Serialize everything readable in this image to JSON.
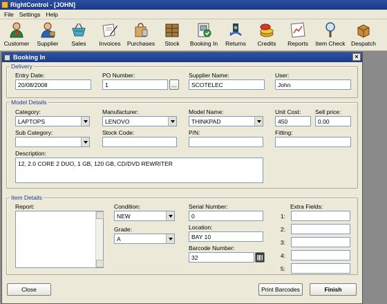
{
  "app": {
    "title": "RightControl - [JOHN]"
  },
  "menu": {
    "items": [
      "File",
      "Settings",
      "Help"
    ]
  },
  "toolbar": {
    "buttons": [
      {
        "label": "Customer",
        "icon": "customer-icon"
      },
      {
        "label": "Supplier",
        "icon": "supplier-icon"
      },
      {
        "label": "Sales",
        "icon": "sales-basket-icon"
      },
      {
        "label": "Invoices",
        "icon": "invoices-pen-icon"
      },
      {
        "label": "Purchases",
        "icon": "purchases-bag-icon"
      },
      {
        "label": "Stock",
        "icon": "stock-boxes-icon"
      },
      {
        "label": "Booking In",
        "icon": "booking-in-icon"
      },
      {
        "label": "Returns",
        "icon": "returns-icon"
      },
      {
        "label": "Credits",
        "icon": "credits-coins-icon"
      },
      {
        "label": "Reports",
        "icon": "reports-chart-icon"
      },
      {
        "label": "Item Check",
        "icon": "item-check-magnifier-icon"
      },
      {
        "label": "Despatch",
        "icon": "despatch-box-icon"
      }
    ]
  },
  "dialog": {
    "title": "Booking In",
    "close_glyph": "×",
    "delivery": {
      "group_title": "Delivery",
      "entry_date_label": "Entry Date:",
      "entry_date": "20/08/2008",
      "po_number_label": "PO Number:",
      "po_number": "1",
      "po_browse": "...",
      "supplier_name_label": "Supplier Name:",
      "supplier_name": "SCOTELEC",
      "user_label": "User:",
      "user": "John"
    },
    "model": {
      "group_title": "Model Details",
      "category_label": "Category:",
      "category": "LAPTOPS",
      "manufacturer_label": "Manufacturer:",
      "manufacturer": "LENOVO",
      "model_name_label": "Model Name:",
      "model_name": "THINKPAD",
      "unit_cost_label": "Unit Cost:",
      "unit_cost": "450",
      "sell_price_label": "Sell price:",
      "sell_price": "0.00",
      "sub_category_label": "Sub Category:",
      "sub_category": "",
      "stock_code_label": "Stock Code:",
      "stock_code": "",
      "pn_label": "P/N:",
      "pn": "",
      "fitting_label": "Fitting:",
      "fitting": "",
      "description_label": "Description:",
      "description": "12, 2.0 CORE 2 DUO, 1 GB, 120 GB, CD/DVD REWRITER"
    },
    "item": {
      "group_title": "Item Details",
      "report_label": "Report:",
      "condition_label": "Condition:",
      "condition": "NEW",
      "grade_label": "Grade:",
      "grade": "A",
      "serial_label": "Serial Number:",
      "serial": "0",
      "location_label": "Location:",
      "location": "BAY 10",
      "barcode_label": "Barcode Number:",
      "barcode": "32",
      "extra_fields_label": "Extra Fields:",
      "extra_indexes": [
        "1:",
        "2:",
        "3:",
        "4:",
        "5:"
      ]
    },
    "buttons": {
      "close": "Close",
      "print_barcodes": "Print Barcodes",
      "finish": "Finish"
    }
  }
}
